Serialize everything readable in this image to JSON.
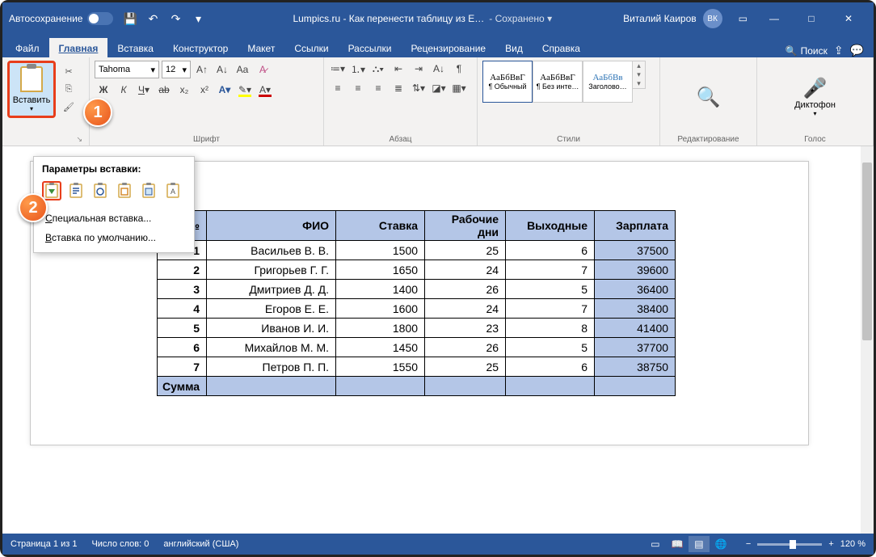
{
  "titlebar": {
    "autosave_label": "Автосохранение",
    "doc_name": "Lumpics.ru - Как перенести таблицу из E…",
    "saved_state": "Сохранено",
    "user_name": "Виталий Каиров",
    "user_initials": "ВК"
  },
  "tabs": {
    "items": [
      "Файл",
      "Главная",
      "Вставка",
      "Конструктор",
      "Макет",
      "Ссылки",
      "Рассылки",
      "Рецензирование",
      "Вид",
      "Справка"
    ],
    "active_index": 1,
    "search_placeholder": "Поиск"
  },
  "ribbon": {
    "clipboard": {
      "paste_label": "Вставить",
      "group_label": ""
    },
    "font": {
      "font_name": "Tahoma",
      "font_size": "12",
      "group_label": "Шрифт"
    },
    "paragraph": {
      "group_label": "Абзац"
    },
    "styles": {
      "group_label": "Стили",
      "items": [
        {
          "preview": "АаБбВвГ",
          "name": "¶ Обычный"
        },
        {
          "preview": "АаБбВвГ",
          "name": "¶ Без инте…"
        },
        {
          "preview": "АаБбВв",
          "name": "Заголово…"
        }
      ]
    },
    "editing": {
      "group_label": "Редактирование"
    },
    "dictation": {
      "label": "Диктофон",
      "group_label": "Голос"
    }
  },
  "paste_menu": {
    "title": "Параметры вставки:",
    "special": "Специальная вставка...",
    "default": "Вставка по умолчанию..."
  },
  "table": {
    "headers": [
      "№",
      "ФИО",
      "Ставка",
      "Рабочие дни",
      "Выходные",
      "Зарплата"
    ],
    "rows": [
      {
        "num": "1",
        "fio": "Васильев В. В.",
        "rate": "1500",
        "days": "25",
        "off": "6",
        "salary": "37500"
      },
      {
        "num": "2",
        "fio": "Григорьев Г. Г.",
        "rate": "1650",
        "days": "24",
        "off": "7",
        "salary": "39600"
      },
      {
        "num": "3",
        "fio": "Дмитриев Д. Д.",
        "rate": "1400",
        "days": "26",
        "off": "5",
        "salary": "36400"
      },
      {
        "num": "4",
        "fio": "Егоров Е. Е.",
        "rate": "1600",
        "days": "24",
        "off": "7",
        "salary": "38400"
      },
      {
        "num": "5",
        "fio": "Иванов И. И.",
        "rate": "1800",
        "days": "23",
        "off": "8",
        "salary": "41400"
      },
      {
        "num": "6",
        "fio": "Михайлов М. М.",
        "rate": "1450",
        "days": "26",
        "off": "5",
        "salary": "37700"
      },
      {
        "num": "7",
        "fio": "Петров П. П.",
        "rate": "1550",
        "days": "25",
        "off": "6",
        "salary": "38750"
      }
    ],
    "sum_label": "Сумма"
  },
  "statusbar": {
    "page": "Страница 1 из 1",
    "words": "Число слов: 0",
    "lang": "английский (США)",
    "zoom": "120 %"
  },
  "badges": {
    "one": "1",
    "two": "2"
  }
}
